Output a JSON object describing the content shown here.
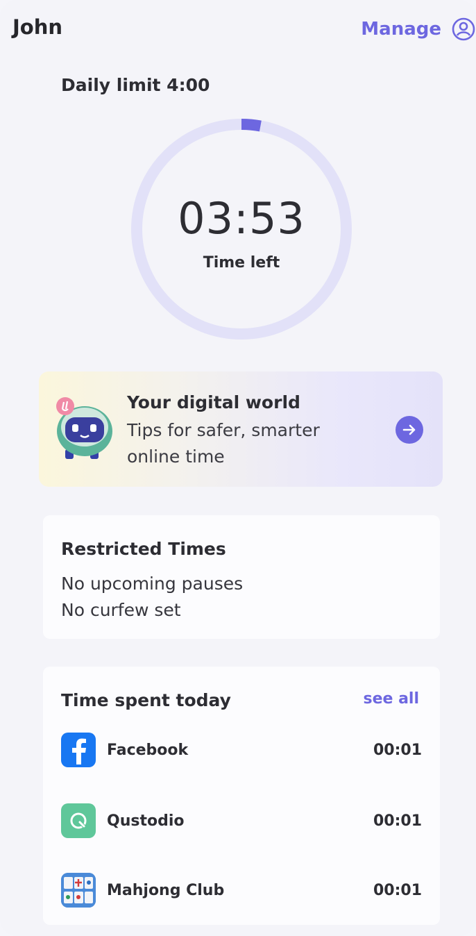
{
  "header": {
    "child_name": "John",
    "manage_label": "Manage",
    "profile_icon": "user-circle-icon"
  },
  "daily_limit": {
    "label": "Daily limit 4:00",
    "time_left_value": "03:53",
    "time_left_label": "Time left",
    "used_fraction": 0.029
  },
  "promo": {
    "title": "Your digital world",
    "subtitle": "Tips for safer, smarter online time",
    "icon": "arrow-right-icon"
  },
  "restricted": {
    "title": "Restricted Times",
    "lines": [
      "No upcoming pauses",
      "No curfew set"
    ]
  },
  "time_spent": {
    "title": "Time spent today",
    "see_all_label": "see all",
    "apps": [
      {
        "name": "Facebook",
        "time": "00:01",
        "icon": "facebook-icon"
      },
      {
        "name": "Qustodio",
        "time": "00:01",
        "icon": "qustodio-icon"
      },
      {
        "name": "Mahjong Club",
        "time": "00:01",
        "icon": "mahjong-icon"
      }
    ]
  },
  "colors": {
    "accent": "#6d67e0",
    "ring_track": "#e2e1f8",
    "background": "#f4f4f9"
  }
}
